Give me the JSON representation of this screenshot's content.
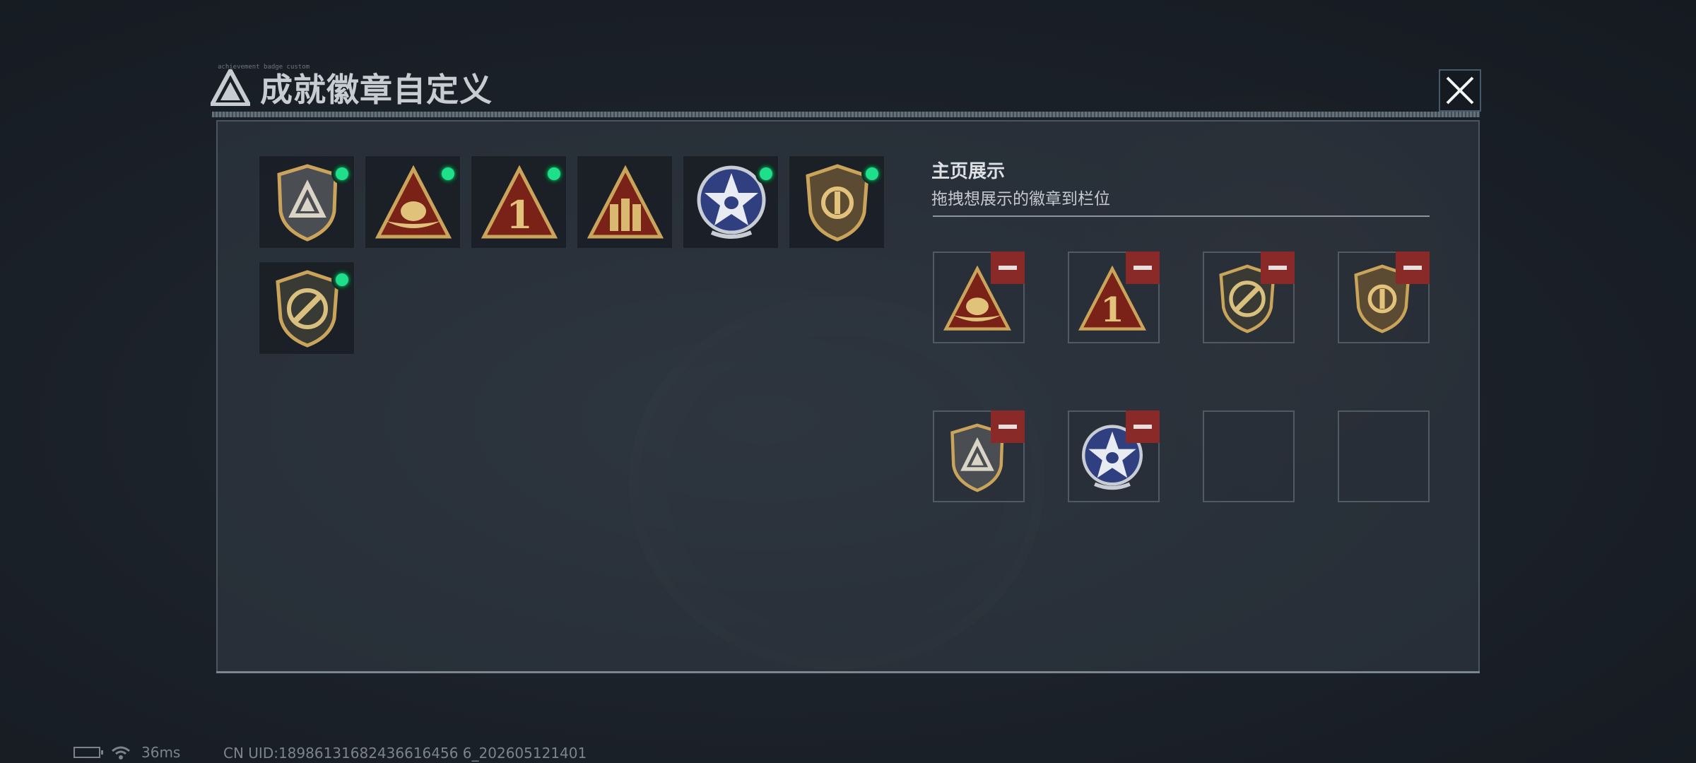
{
  "dialog": {
    "title": "成就徽章自定义",
    "title_tiny": "achievement badge custom",
    "close_icon": "close-icon"
  },
  "collection": {
    "badges": [
      {
        "icon": "shield-triangle-badge-icon",
        "equipped": true
      },
      {
        "icon": "triangle-eagle-badge-icon",
        "equipped": true
      },
      {
        "icon": "triangle-number-one-badge-icon",
        "equipped": true
      },
      {
        "icon": "triangle-soldiers-badge-icon",
        "equipped": false
      },
      {
        "icon": "star-skull-badge-icon",
        "equipped": true
      },
      {
        "icon": "shield-circle-badge-icon",
        "equipped": true
      },
      {
        "icon": "shield-knife-badge-icon",
        "equipped": true
      }
    ]
  },
  "showcase": {
    "title": "主页展示",
    "subtitle": "拖拽想展示的徽章到栏位",
    "slots": [
      {
        "icon": "triangle-eagle-badge-icon",
        "filled": true
      },
      {
        "icon": "triangle-number-one-badge-icon",
        "filled": true
      },
      {
        "icon": "shield-knife-badge-icon",
        "filled": true
      },
      {
        "icon": "shield-circle-badge-icon",
        "filled": true
      },
      {
        "icon": "shield-triangle-badge-icon",
        "filled": true
      },
      {
        "icon": "star-skull-badge-icon",
        "filled": true
      },
      {
        "icon": "",
        "filled": false
      },
      {
        "icon": "",
        "filled": false
      }
    ]
  },
  "status_bar": {
    "ping": "36ms",
    "uid": "CN UID:18986131682436616456 6_202605121401"
  },
  "colors": {
    "equipped_dot": "#1ee08a",
    "remove_button": "#8a2a28",
    "gold": "#c9a45a",
    "dark_red": "#7a2118"
  }
}
